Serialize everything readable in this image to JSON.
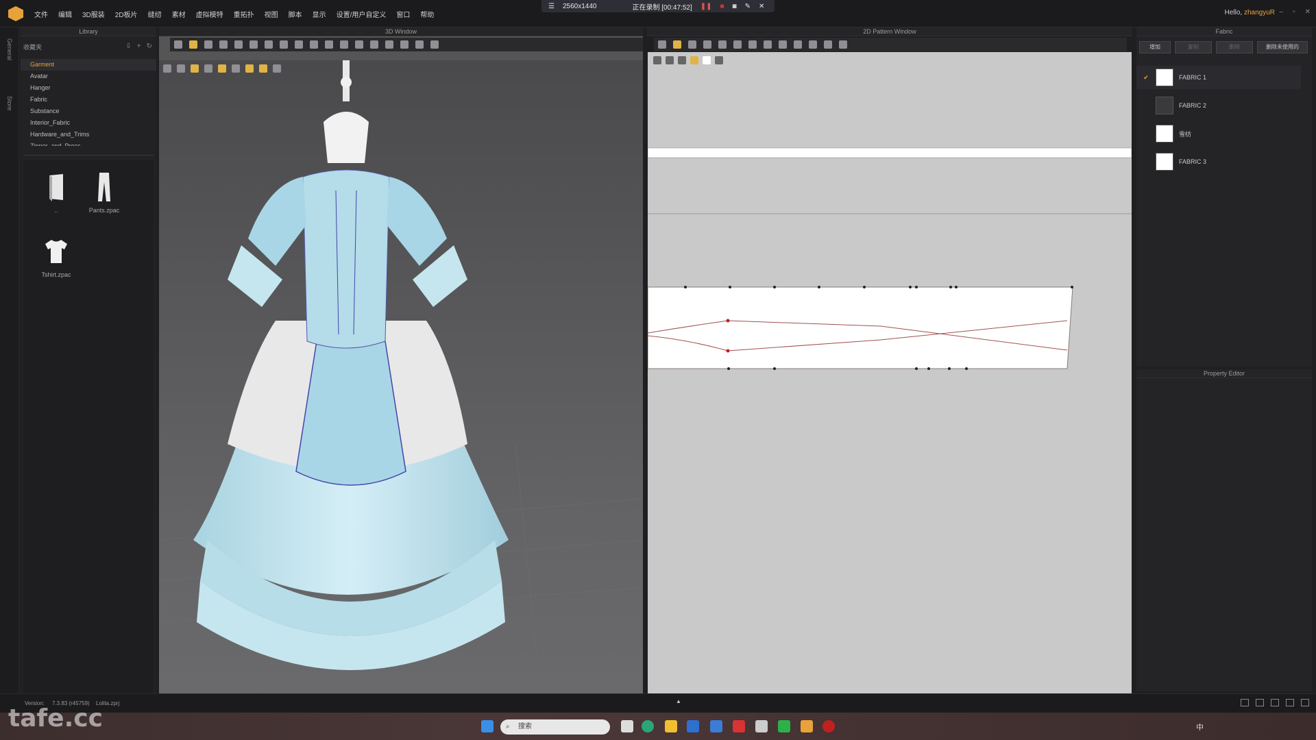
{
  "menubar": {
    "items": [
      "文件",
      "编辑",
      "3D服装",
      "2D板片",
      "缝纫",
      "素材",
      "虚拟模特",
      "重拓扑",
      "视图",
      "脚本",
      "显示",
      "设置/用户自定义",
      "窗口",
      "帮助"
    ],
    "greeting": "Hello,",
    "username": "zhangyuR"
  },
  "recording": {
    "resolution": "2560x1440",
    "status": "正在录制 [00:47:52]"
  },
  "sidebar": {
    "tabs": [
      "General",
      "Store"
    ]
  },
  "library": {
    "title": "Library",
    "favorites_label": "收藏夹",
    "tree": [
      "Garment",
      "Avatar",
      "Hanger",
      "Fabric",
      "Substance",
      "Interior_Fabric",
      "Hardware_and_Trims",
      "Zipper_and_Press"
    ],
    "selected": "Garment",
    "files": [
      {
        "name": "..",
        "icon": "folder-icon"
      },
      {
        "name": "Pants.zpac",
        "icon": "pants-icon"
      },
      {
        "name": "Tshirt.zpac",
        "icon": "tshirt-icon"
      }
    ]
  },
  "window3d": {
    "title": "3D Window"
  },
  "window2d": {
    "title": "2D Pattern Window"
  },
  "fabric": {
    "title": "Fabric",
    "buttons": [
      "增加",
      "复制",
      "删除",
      "删除未使用的"
    ],
    "items": [
      {
        "name": "FABRIC 1",
        "checked": true,
        "color": "#ffffff"
      },
      {
        "name": "FABRIC 2",
        "checked": false,
        "color": "#3a3a3d"
      },
      {
        "name": "雪纺",
        "checked": false,
        "color": "#ffffff"
      },
      {
        "name": "FABRIC 3",
        "checked": false,
        "color": "#ffffff"
      }
    ]
  },
  "property_editor": {
    "title": "Property Editor"
  },
  "status": {
    "version_label": "Version:",
    "version": "7.3.83 (r45759)",
    "file": "Lolita.zprj"
  },
  "taskbar": {
    "search_placeholder": "搜索"
  },
  "watermark": "tafe.cc",
  "colors": {
    "accent": "#e8a23a",
    "garment": "#bfe3ee",
    "background": "#1f1f21"
  }
}
